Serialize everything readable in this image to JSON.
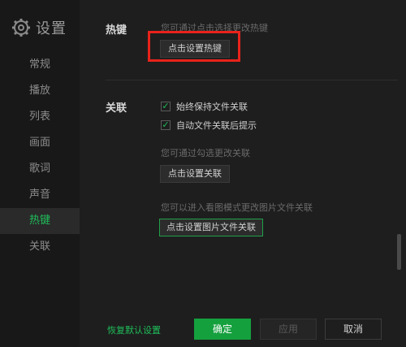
{
  "sidebar": {
    "title": "设置",
    "items": [
      {
        "label": "常规"
      },
      {
        "label": "播放"
      },
      {
        "label": "列表"
      },
      {
        "label": "画面"
      },
      {
        "label": "歌词"
      },
      {
        "label": "声音"
      },
      {
        "label": "热键",
        "active": true
      },
      {
        "label": "关联"
      }
    ]
  },
  "hotkey": {
    "label": "热键",
    "hint": "您可通过点击选择更改热键",
    "button": "点击设置热键"
  },
  "assoc": {
    "label": "关联",
    "checks": [
      {
        "label": "始终保持文件关联",
        "checked": true
      },
      {
        "label": "自动文件关联后提示",
        "checked": true
      }
    ],
    "hint1": "您可通过勾选更改关联",
    "button1": "点击设置关联",
    "hint2": "您可以进入看图模式更改图片文件关联",
    "button2": "点击设置图片文件关联"
  },
  "footer": {
    "restore": "恢复默认设置",
    "ok": "确定",
    "apply": "应用",
    "cancel": "取消"
  },
  "colors": {
    "accent": "#1fbf5a",
    "highlight": "#e8231b"
  }
}
